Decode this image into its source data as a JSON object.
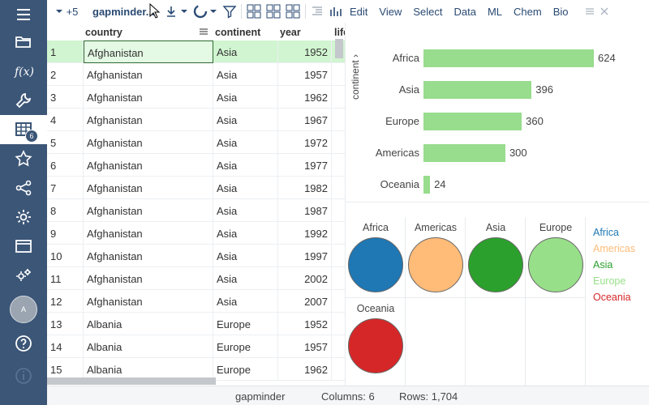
{
  "toolbar": {
    "more_label": "+5",
    "table_name": "gapminder...",
    "menu": [
      "Edit",
      "View",
      "Select",
      "Data",
      "ML",
      "Chem",
      "Bio"
    ]
  },
  "sidebar": {
    "badge_count": "6",
    "avatar_initial": "A"
  },
  "grid": {
    "columns": [
      "country",
      "continent",
      "year",
      "life"
    ],
    "rows": [
      {
        "num": "1",
        "country": "Afghanistan",
        "continent": "Asia",
        "year": "1952"
      },
      {
        "num": "2",
        "country": "Afghanistan",
        "continent": "Asia",
        "year": "1957"
      },
      {
        "num": "3",
        "country": "Afghanistan",
        "continent": "Asia",
        "year": "1962"
      },
      {
        "num": "4",
        "country": "Afghanistan",
        "continent": "Asia",
        "year": "1967"
      },
      {
        "num": "5",
        "country": "Afghanistan",
        "continent": "Asia",
        "year": "1972"
      },
      {
        "num": "6",
        "country": "Afghanistan",
        "continent": "Asia",
        "year": "1977"
      },
      {
        "num": "7",
        "country": "Afghanistan",
        "continent": "Asia",
        "year": "1982"
      },
      {
        "num": "8",
        "country": "Afghanistan",
        "continent": "Asia",
        "year": "1987"
      },
      {
        "num": "9",
        "country": "Afghanistan",
        "continent": "Asia",
        "year": "1992"
      },
      {
        "num": "10",
        "country": "Afghanistan",
        "continent": "Asia",
        "year": "1997"
      },
      {
        "num": "11",
        "country": "Afghanistan",
        "continent": "Asia",
        "year": "2002"
      },
      {
        "num": "12",
        "country": "Afghanistan",
        "continent": "Asia",
        "year": "2007"
      },
      {
        "num": "13",
        "country": "Albania",
        "continent": "Europe",
        "year": "1952"
      },
      {
        "num": "14",
        "country": "Albania",
        "continent": "Europe",
        "year": "1957"
      },
      {
        "num": "15",
        "country": "Albania",
        "continent": "Europe",
        "year": "1962"
      }
    ]
  },
  "bar_chart": {
    "axis_label": "continent",
    "categories": [
      "Africa",
      "Asia",
      "Europe",
      "Americas",
      "Oceania"
    ],
    "values": [
      624,
      396,
      360,
      300,
      24
    ],
    "bar_color": "#98dc8d"
  },
  "pie_chart": {
    "cells": [
      {
        "title": "Africa",
        "color": "#1f77b4"
      },
      {
        "title": "Americas",
        "color": "#ffbb78"
      },
      {
        "title": "Asia",
        "color": "#2ca02c"
      },
      {
        "title": "Europe",
        "color": "#98df8a"
      },
      {
        "title": "Oceania",
        "color": "#d62728"
      }
    ],
    "legend": [
      {
        "label": "Africa",
        "color": "#1f77b4"
      },
      {
        "label": "Americas",
        "color": "#ffbb78"
      },
      {
        "label": "Asia",
        "color": "#2ca02c"
      },
      {
        "label": "Europe",
        "color": "#98df8a"
      },
      {
        "label": "Oceania",
        "color": "#d62728"
      }
    ]
  },
  "status": {
    "table": "gapminder",
    "columns": "Columns: 6",
    "rows": "Rows: 1,704"
  },
  "chart_data": [
    {
      "type": "bar",
      "categories": [
        "Africa",
        "Asia",
        "Europe",
        "Americas",
        "Oceania"
      ],
      "values": [
        624,
        396,
        360,
        300,
        24
      ],
      "ylabel": "continent",
      "orientation": "horizontal"
    },
    {
      "type": "pie",
      "categories": [
        "Africa",
        "Americas",
        "Asia",
        "Europe",
        "Oceania"
      ],
      "values": [
        1,
        1,
        1,
        1,
        1
      ]
    }
  ]
}
